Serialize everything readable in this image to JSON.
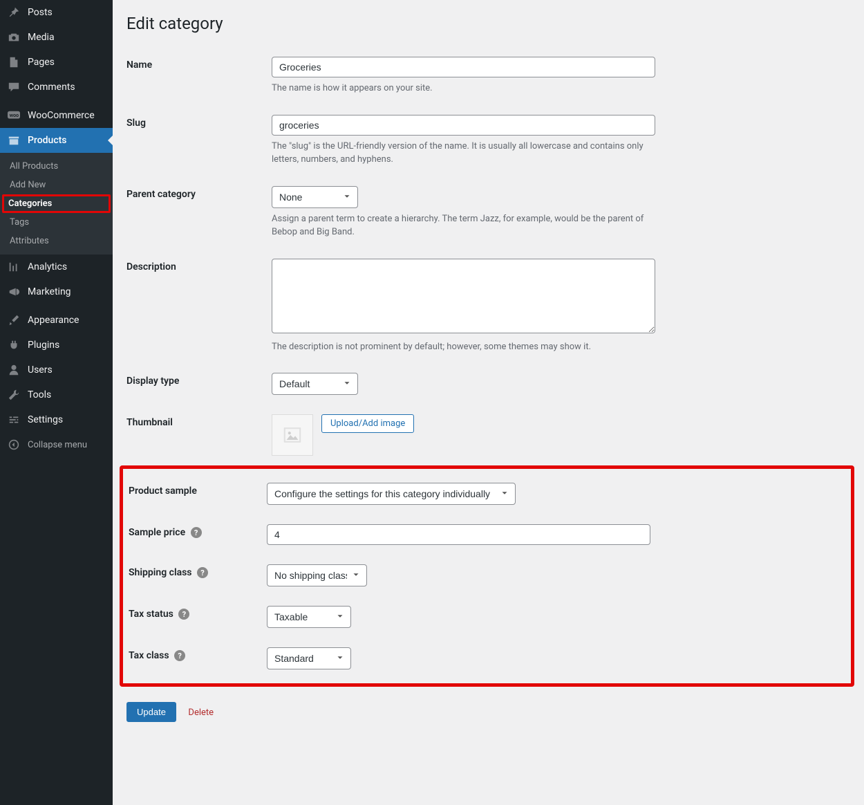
{
  "sidebar": {
    "posts": "Posts",
    "media": "Media",
    "pages": "Pages",
    "comments": "Comments",
    "woocommerce": "WooCommerce",
    "products": "Products",
    "products_sub": {
      "all": "All Products",
      "add_new": "Add New",
      "categories": "Categories",
      "tags": "Tags",
      "attributes": "Attributes"
    },
    "analytics": "Analytics",
    "marketing": "Marketing",
    "appearance": "Appearance",
    "plugins": "Plugins",
    "users": "Users",
    "tools": "Tools",
    "settings": "Settings",
    "collapse": "Collapse menu"
  },
  "page": {
    "title": "Edit category"
  },
  "fields": {
    "name": {
      "label": "Name",
      "value": "Groceries",
      "desc": "The name is how it appears on your site."
    },
    "slug": {
      "label": "Slug",
      "value": "groceries",
      "desc": "The \"slug\" is the URL-friendly version of the name. It is usually all lowercase and contains only letters, numbers, and hyphens."
    },
    "parent": {
      "label": "Parent category",
      "value": "None",
      "desc": "Assign a parent term to create a hierarchy. The term Jazz, for example, would be the parent of Bebop and Big Band."
    },
    "description": {
      "label": "Description",
      "value": "",
      "desc": "The description is not prominent by default; however, some themes may show it."
    },
    "display_type": {
      "label": "Display type",
      "value": "Default"
    },
    "thumbnail": {
      "label": "Thumbnail",
      "button": "Upload/Add image"
    },
    "product_sample": {
      "label": "Product sample",
      "value": "Configure the settings for this category individually"
    },
    "sample_price": {
      "label": "Sample price",
      "value": "4"
    },
    "shipping_class": {
      "label": "Shipping class",
      "value": "No shipping class"
    },
    "tax_status": {
      "label": "Tax status",
      "value": "Taxable"
    },
    "tax_class": {
      "label": "Tax class",
      "value": "Standard"
    }
  },
  "actions": {
    "update": "Update",
    "delete": "Delete"
  }
}
